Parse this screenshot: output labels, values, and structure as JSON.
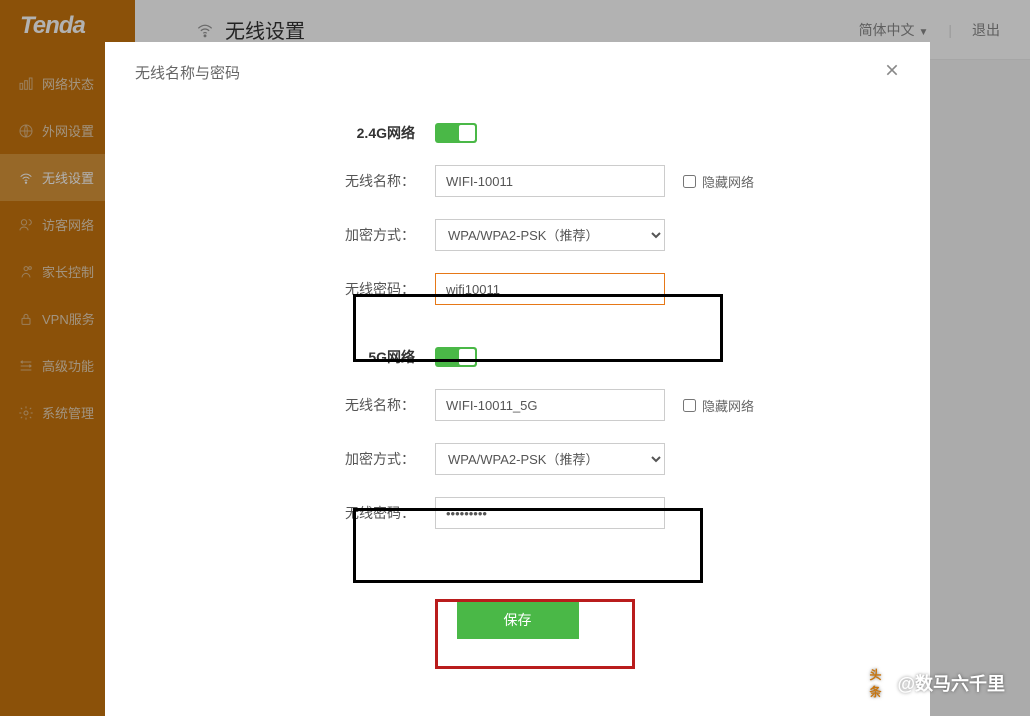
{
  "brand": "Tenda",
  "header": {
    "title": "无线设置",
    "lang_selector": "简体中文",
    "logout": "退出"
  },
  "sidebar": {
    "items": [
      {
        "label": "网络状态",
        "icon": "status-icon"
      },
      {
        "label": "外网设置",
        "icon": "globe-icon"
      },
      {
        "label": "无线设置",
        "icon": "wifi-icon",
        "active": true
      },
      {
        "label": "访客网络",
        "icon": "guest-icon"
      },
      {
        "label": "家长控制",
        "icon": "parent-icon"
      },
      {
        "label": "VPN服务",
        "icon": "vpn-icon"
      },
      {
        "label": "高级功能",
        "icon": "advanced-icon"
      },
      {
        "label": "系统管理",
        "icon": "system-icon"
      }
    ]
  },
  "modal": {
    "title": "无线名称与密码",
    "g24": {
      "heading": "2.4G网络",
      "enabled": true,
      "name_label": "无线名称：",
      "name_value": "WIFI-10011",
      "hide_label": "隐藏网络",
      "hide_checked": false,
      "enc_label": "加密方式：",
      "enc_value": "WPA/WPA2-PSK（推荐）",
      "pwd_label": "无线密码：",
      "pwd_value": "wifi10011"
    },
    "g5": {
      "heading": "5G网络",
      "enabled": true,
      "name_label": "无线名称：",
      "name_value": "WIFI-10011_5G",
      "hide_label": "隐藏网络",
      "hide_checked": false,
      "enc_label": "加密方式：",
      "enc_value": "WPA/WPA2-PSK（推荐）",
      "pwd_label": "无线密码：",
      "pwd_value": "•••••••••"
    },
    "save_label": "保存"
  },
  "watermark": {
    "prefix": "头条",
    "handle": "@数马六千里"
  }
}
